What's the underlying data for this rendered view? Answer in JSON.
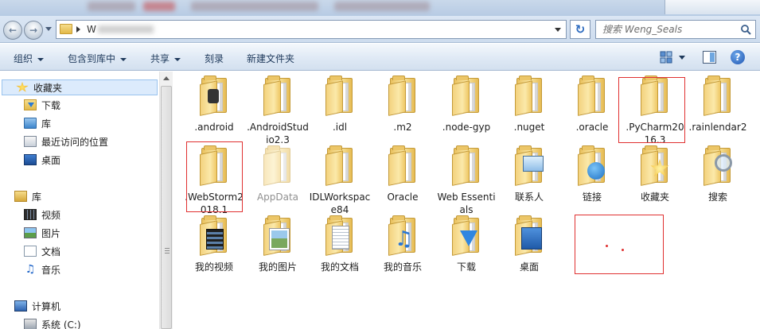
{
  "address": {
    "path_text": "W",
    "search_placeholder": "搜索 Weng_Seals"
  },
  "toolbar": {
    "organize": "组织",
    "include_in_library": "包含到库中",
    "share": "共享",
    "burn": "刻录",
    "new_folder": "新建文件夹"
  },
  "nav": {
    "favorites": "收藏夹",
    "downloads": "下载",
    "library_short": "库",
    "recent": "最近访问的位置",
    "desktop": "桌面",
    "libraries": "库",
    "videos": "视频",
    "pictures": "图片",
    "documents": "文档",
    "music": "音乐",
    "computer": "计算机",
    "system_c": "系统 (C:)"
  },
  "items": [
    {
      "label": ".android",
      "icon": "folder-gear-icon"
    },
    {
      "label": ".AndroidStudio2.3",
      "icon": "folder-icon"
    },
    {
      "label": ".idl",
      "icon": "folder-icon"
    },
    {
      "label": ".m2",
      "icon": "folder-icon"
    },
    {
      "label": ".node-gyp",
      "icon": "folder-icon"
    },
    {
      "label": ".nuget",
      "icon": "folder-icon"
    },
    {
      "label": ".oracle",
      "icon": "folder-icon"
    },
    {
      "label": ".PyCharm2016.3",
      "icon": "folder-icon"
    },
    {
      "label": ".rainlendar2",
      "icon": "folder-icon"
    },
    {
      "label": ".WebStorm2018.1",
      "icon": "folder-icon"
    },
    {
      "label": "AppData",
      "icon": "folder-hidden-icon"
    },
    {
      "label": "IDLWorkspace84",
      "icon": "folder-icon"
    },
    {
      "label": "Oracle",
      "icon": "folder-icon"
    },
    {
      "label": "Web Essentials",
      "icon": "folder-icon"
    },
    {
      "label": "联系人",
      "icon": "contacts-icon"
    },
    {
      "label": "链接",
      "icon": "links-icon"
    },
    {
      "label": "收藏夹",
      "icon": "favorites-icon"
    },
    {
      "label": "搜索",
      "icon": "searches-icon"
    },
    {
      "label": "我的视频",
      "icon": "my-videos-icon"
    },
    {
      "label": "我的图片",
      "icon": "my-pictures-icon"
    },
    {
      "label": "我的文档",
      "icon": "my-documents-icon"
    },
    {
      "label": "我的音乐",
      "icon": "my-music-icon"
    },
    {
      "label": "下载",
      "icon": "downloads-icon"
    },
    {
      "label": "桌面",
      "icon": "desktop-icon"
    }
  ],
  "colors": {
    "annotation": "#e03030",
    "toolbar_text": "#1e395b",
    "selection": "#dcebfc"
  }
}
